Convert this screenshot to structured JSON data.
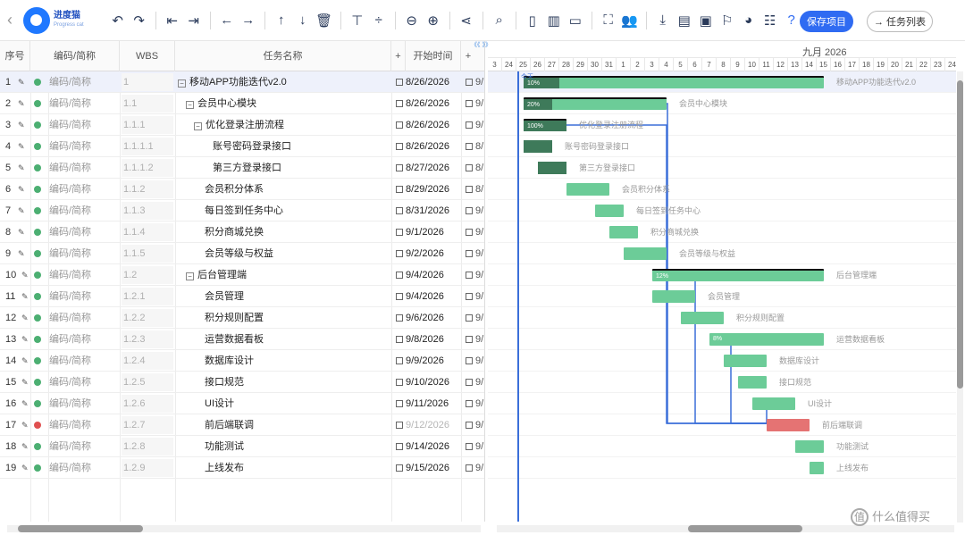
{
  "toolbar": {
    "logo": {
      "name": "进度猫",
      "sub": "Progress cat"
    },
    "icons": [
      "undo-icon",
      "redo-icon",
      "indent-icon",
      "outdent-icon",
      "move-left-icon",
      "move-right-icon",
      "move-up-icon",
      "move-down-icon",
      "delete-icon",
      "expand-icon",
      "collapse-icon",
      "zoom-out-icon",
      "zoom-in-icon",
      "link-icon",
      "search-icon",
      "layout-1-icon",
      "layout-2-icon",
      "layout-3-icon",
      "fullscreen-icon",
      "resources-icon",
      "download-icon",
      "excel-icon",
      "image-icon",
      "flag-icon",
      "palette-icon",
      "notes-icon",
      "help-icon"
    ],
    "save_label": "保存项目",
    "tasklist_label": "→ 任务列表"
  },
  "grid": {
    "headers": {
      "no": "序号",
      "code": "编码/简称",
      "wbs": "WBS",
      "name": "任务名称",
      "add": "+",
      "start": "开始时间",
      "add2": "+"
    },
    "rows": [
      {
        "no": "1",
        "code": "编码/简称",
        "wbs": "1",
        "name": "移动APP功能迭代v2.0",
        "indent": 0,
        "toggle": "−",
        "start": "8/26/2026",
        "end": "9/",
        "status": "green",
        "selected": true
      },
      {
        "no": "2",
        "code": "编码/简称",
        "wbs": "1.1",
        "name": "会员中心模块",
        "indent": 1,
        "toggle": "−",
        "start": "8/26/2026",
        "end": "9/",
        "status": "green"
      },
      {
        "no": "3",
        "code": "编码/简称",
        "wbs": "1.1.1",
        "name": "优化登录注册流程",
        "indent": 2,
        "toggle": "−",
        "start": "8/26/2026",
        "end": "9/",
        "status": "green"
      },
      {
        "no": "4",
        "code": "编码/简称",
        "wbs": "1.1.1.1",
        "name": "账号密码登录接口",
        "indent": 3,
        "toggle": "",
        "start": "8/26/2026",
        "end": "8/",
        "status": "green"
      },
      {
        "no": "5",
        "code": "编码/简称",
        "wbs": "1.1.1.2",
        "name": "第三方登录接口",
        "indent": 3,
        "toggle": "",
        "start": "8/27/2026",
        "end": "8/",
        "status": "green"
      },
      {
        "no": "6",
        "code": "编码/简称",
        "wbs": "1.1.2",
        "name": "会员积分体系",
        "indent": 2,
        "toggle": "",
        "start": "8/29/2026",
        "end": "8/",
        "status": "green"
      },
      {
        "no": "7",
        "code": "编码/简称",
        "wbs": "1.1.3",
        "name": "每日签到任务中心",
        "indent": 2,
        "toggle": "",
        "start": "8/31/2026",
        "end": "9/",
        "status": "green"
      },
      {
        "no": "8",
        "code": "编码/简称",
        "wbs": "1.1.4",
        "name": "积分商城兑换",
        "indent": 2,
        "toggle": "",
        "start": "9/1/2026",
        "end": "9/",
        "status": "green"
      },
      {
        "no": "9",
        "code": "编码/简称",
        "wbs": "1.1.5",
        "name": "会员等级与权益",
        "indent": 2,
        "toggle": "",
        "start": "9/2/2026",
        "end": "9/",
        "status": "green"
      },
      {
        "no": "10",
        "code": "编码/简称",
        "wbs": "1.2",
        "name": "后台管理端",
        "indent": 1,
        "toggle": "−",
        "start": "9/4/2026",
        "end": "9/",
        "status": "green"
      },
      {
        "no": "11",
        "code": "编码/简称",
        "wbs": "1.2.1",
        "name": "会员管理",
        "indent": 2,
        "toggle": "",
        "start": "9/4/2026",
        "end": "9/",
        "status": "green"
      },
      {
        "no": "12",
        "code": "编码/简称",
        "wbs": "1.2.2",
        "name": "积分规则配置",
        "indent": 2,
        "toggle": "",
        "start": "9/6/2026",
        "end": "9/",
        "status": "green"
      },
      {
        "no": "13",
        "code": "编码/简称",
        "wbs": "1.2.3",
        "name": "运营数据看板",
        "indent": 2,
        "toggle": "",
        "start": "9/8/2026",
        "end": "9/",
        "status": "green"
      },
      {
        "no": "14",
        "code": "编码/简称",
        "wbs": "1.2.4",
        "name": "数据库设计",
        "indent": 2,
        "toggle": "",
        "start": "9/9/2026",
        "end": "9/",
        "status": "green"
      },
      {
        "no": "15",
        "code": "编码/简称",
        "wbs": "1.2.5",
        "name": "接口规范",
        "indent": 2,
        "toggle": "",
        "start": "9/10/2026",
        "end": "9/",
        "status": "green"
      },
      {
        "no": "16",
        "code": "编码/简称",
        "wbs": "1.2.6",
        "name": "UI设计",
        "indent": 2,
        "toggle": "",
        "start": "9/11/2026",
        "end": "9/",
        "status": "green"
      },
      {
        "no": "17",
        "code": "编码/简称",
        "wbs": "1.2.7",
        "name": "前后端联调",
        "indent": 2,
        "toggle": "",
        "start": "9/12/2026",
        "end": "9/",
        "status": "red",
        "start_gray": true
      },
      {
        "no": "18",
        "code": "编码/简称",
        "wbs": "1.2.8",
        "name": "功能测试",
        "indent": 2,
        "toggle": "",
        "start": "9/14/2026",
        "end": "9/",
        "status": "green"
      },
      {
        "no": "19",
        "code": "编码/简称",
        "wbs": "1.2.9",
        "name": "上线发布",
        "indent": 2,
        "toggle": "",
        "start": "9/15/2026",
        "end": "9/",
        "status": "green"
      }
    ]
  },
  "gantt": {
    "zoom_label": "《《 》》",
    "today_label": "今天",
    "month_label": "九月 2026",
    "days": [
      "3",
      "24",
      "25",
      "26",
      "27",
      "28",
      "29",
      "30",
      "31",
      "1",
      "2",
      "3",
      "4",
      "5",
      "6",
      "7",
      "8",
      "9",
      "10",
      "11",
      "12",
      "13",
      "14",
      "15",
      "16",
      "17",
      "18",
      "19",
      "20",
      "21",
      "22",
      "23",
      "24"
    ],
    "tasks": [
      {
        "start": 0,
        "dur": 21,
        "label": "移动APP功能迭代v2.0",
        "pct": "10%",
        "progress": 0.1,
        "summary": true
      },
      {
        "start": 0,
        "dur": 10,
        "label": "会员中心模块",
        "pct": "20%",
        "progress": 0.2,
        "summary": true
      },
      {
        "start": 0,
        "dur": 3,
        "label": "优化登录注册流程",
        "pct": "100%",
        "progress": 1.0,
        "summary": true
      },
      {
        "start": 0,
        "dur": 2,
        "label": "账号密码登录接口",
        "pct": "",
        "progress": 1.0
      },
      {
        "start": 1,
        "dur": 2,
        "label": "第三方登录接口",
        "pct": "",
        "progress": 1.0
      },
      {
        "start": 3,
        "dur": 3,
        "label": "会员积分体系",
        "pct": "",
        "progress": 0
      },
      {
        "start": 5,
        "dur": 2,
        "label": "每日签到任务中心",
        "pct": "",
        "progress": 0
      },
      {
        "start": 6,
        "dur": 2,
        "label": "积分商城兑换",
        "pct": "",
        "progress": 0
      },
      {
        "start": 7,
        "dur": 3,
        "label": "会员等级与权益",
        "pct": "",
        "progress": 0
      },
      {
        "start": 9,
        "dur": 12,
        "label": "后台管理端",
        "pct": "12%",
        "progress": 0.0,
        "summary": true
      },
      {
        "start": 9,
        "dur": 3,
        "label": "会员管理",
        "pct": "",
        "progress": 0
      },
      {
        "start": 11,
        "dur": 3,
        "label": "积分规则配置",
        "pct": "",
        "progress": 0
      },
      {
        "start": 13,
        "dur": 8,
        "label": "运营数据看板",
        "pct": "8%",
        "progress": 0
      },
      {
        "start": 14,
        "dur": 3,
        "label": "数据库设计",
        "pct": "",
        "progress": 0
      },
      {
        "start": 15,
        "dur": 2,
        "label": "接口规范",
        "pct": "",
        "progress": 0
      },
      {
        "start": 16,
        "dur": 3,
        "label": "UI设计",
        "pct": "",
        "progress": 0
      },
      {
        "start": 17,
        "dur": 3,
        "label": "前后端联调",
        "pct": "",
        "progress": 0,
        "red": true
      },
      {
        "start": 19,
        "dur": 2,
        "label": "功能测试",
        "pct": "",
        "progress": 0
      },
      {
        "start": 20,
        "dur": 1,
        "label": "上线发布",
        "pct": "",
        "progress": 0
      }
    ]
  },
  "watermark": "什么值得买",
  "colors": {
    "accent": "#2f6bf2",
    "bar": "#6ccc98",
    "progress": "#3e7a5a",
    "critical": "#e57373",
    "link": "#3b6fd9"
  }
}
